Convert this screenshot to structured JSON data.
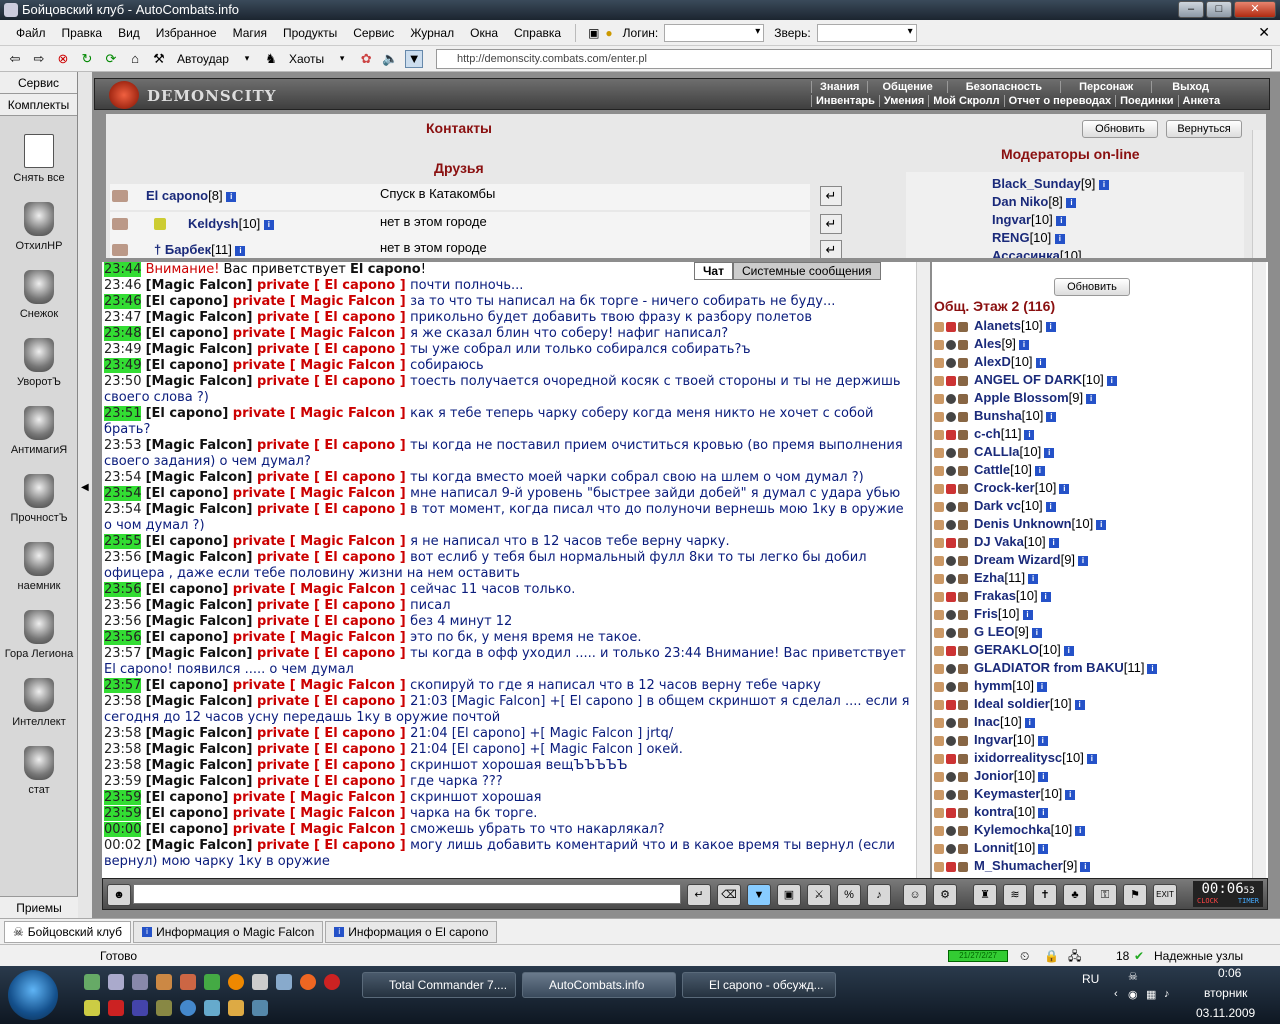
{
  "window": {
    "title": "Бойцовский клуб - AutoCombats.info"
  },
  "menu": {
    "items": [
      "Файл",
      "Правка",
      "Вид",
      "Избранное",
      "Магия",
      "Продукты",
      "Сервис",
      "Журнал",
      "Окна",
      "Справка"
    ],
    "login_label": "Логин:",
    "beast_label": "Зверь:"
  },
  "toolbar": {
    "autoudar": "Автоудар",
    "haoty": "Хаоты",
    "address": "http://demonscity.combats.com/enter.pl"
  },
  "leftpanel": {
    "tab1": "Сервис",
    "tab2": "Комплекты",
    "slots": [
      "Снять все",
      "ОтхилНР",
      "Снежок",
      "УворотЪ",
      "АнтимагиЯ",
      "ПрочностЪ",
      "наемник",
      "Гора Легиона",
      "Интеллект",
      "стат"
    ],
    "bottom": "Приемы"
  },
  "header": {
    "logo": "DEMONSCITY",
    "nav1": [
      "Знания",
      "Общение",
      "Безопасность",
      "Персонаж",
      "Выход"
    ],
    "nav2": [
      "Инвентарь",
      "Умения",
      "Мой Скролл",
      "Отчет о переводах",
      "Поединки",
      "Анкета"
    ]
  },
  "contacts": {
    "title": "Контакты",
    "friends_title": "Друзья",
    "refresh": "Обновить",
    "back": "Вернуться",
    "mods_title": "Модераторы on-line",
    "friends": [
      {
        "name": "El capono",
        "level": "[8]",
        "status": "Спуск в Катакомбы"
      },
      {
        "name": "Keldysh",
        "level": "[10]",
        "status": "нет в этом городе"
      },
      {
        "name": "Барбек",
        "level": "[11]",
        "status": "нет в этом городе"
      }
    ],
    "mods": [
      {
        "name": "Black_Sunday",
        "level": "[9]"
      },
      {
        "name": "Dan Niko",
        "level": "[8]"
      },
      {
        "name": "Ingvar",
        "level": "[10]"
      },
      {
        "name": "RENG",
        "level": "[10]"
      },
      {
        "name": "Ассасинка",
        "level": "[10]"
      }
    ]
  },
  "chat": {
    "tab_chat": "Чат",
    "tab_sys": "Системные сообщения",
    "lines": [
      {
        "t": "23:44",
        "hl": true,
        "sys": true,
        "text": "Внимание! ",
        "text2": "Вас приветствует ",
        "nick": "El capono",
        "end": "!"
      },
      {
        "t": "23:46",
        "hl": false,
        "from": "Magic Falcon",
        "to": "El capono",
        "msg": "почти полночь..."
      },
      {
        "t": "23:46",
        "hl": true,
        "from": "El capono",
        "to": "Magic Falcon",
        "msg": "за то что ты написал на бк торге - ничего собирать не буду..."
      },
      {
        "t": "23:47",
        "hl": false,
        "from": "Magic Falcon",
        "to": "El capono",
        "msg": "прикольно будет добавить твою фразу к разбору полетов"
      },
      {
        "t": "23:48",
        "hl": true,
        "from": "El capono",
        "to": "Magic Falcon",
        "msg": "я же сказал блин что соберу! нафиг написал?"
      },
      {
        "t": "23:49",
        "hl": false,
        "from": "Magic Falcon",
        "to": "El capono",
        "msg": "ты уже собрал или только собирался собирать?ъ"
      },
      {
        "t": "23:49",
        "hl": true,
        "from": "El capono",
        "to": "Magic Falcon",
        "msg": "собираюсь"
      },
      {
        "t": "23:50",
        "hl": false,
        "from": "Magic Falcon",
        "to": "El capono",
        "msg": "тоесть получается очоредной косяк с твоей стороны и ты не держишь своего слова ?)"
      },
      {
        "t": "23:51",
        "hl": true,
        "from": "El capono",
        "to": "Magic Falcon",
        "msg": "как я тебе теперь чарку соберу когда меня никто не хочет с собой брать?"
      },
      {
        "t": "23:53",
        "hl": false,
        "from": "Magic Falcon",
        "to": "El capono",
        "msg": "ты когда не поставил прием очиститься кровью (во премя выполнения своего задания) о чем думал?"
      },
      {
        "t": "23:54",
        "hl": false,
        "from": "Magic Falcon",
        "to": "El capono",
        "msg": "ты когда вместо моей чарки собрал свою на шлем о чом думал ?)"
      },
      {
        "t": "23:54",
        "hl": true,
        "from": "El capono",
        "to": "Magic Falcon",
        "msg": "мне написал 9-й уровень \"быстрее зайди добей\" я думал с удара убью"
      },
      {
        "t": "23:54",
        "hl": false,
        "from": "Magic Falcon",
        "to": "El capono",
        "msg": "в тот момент, когда писал что до полуночи вернешь мою 1ку в оружие о чом думал ?)"
      },
      {
        "t": "23:55",
        "hl": true,
        "from": "El capono",
        "to": "Magic Falcon",
        "msg": "я не написал что в 12 часов тебе верну чарку."
      },
      {
        "t": "23:56",
        "hl": false,
        "from": "Magic Falcon",
        "to": "El capono",
        "msg": "вот еслиб у тебя был нормальный фулл 8ки то ты легко бы добил офицера , даже если тебе половину жизни на нем оставить"
      },
      {
        "t": "23:56",
        "hl": true,
        "from": "El capono",
        "to": "Magic Falcon",
        "msg": "сейчас 11 часов только."
      },
      {
        "t": "23:56",
        "hl": false,
        "from": "Magic Falcon",
        "to": "El capono",
        "msg": "писал"
      },
      {
        "t": "23:56",
        "hl": false,
        "from": "Magic Falcon",
        "to": "El capono",
        "msg": "без 4 минут 12"
      },
      {
        "t": "23:56",
        "hl": true,
        "from": "El capono",
        "to": "Magic Falcon",
        "msg": "это по бк, у меня время не такое."
      },
      {
        "t": "23:57",
        "hl": false,
        "from": "Magic Falcon",
        "to": "El capono",
        "msg": "ты когда в офф уходил ..... и только 23:44 Внимание! Вас приветствует El capono! появился ..... о чем думал"
      },
      {
        "t": "23:57",
        "hl": true,
        "from": "El capono",
        "to": "Magic Falcon",
        "msg": "скопируй то где я написал что в 12 часов верну тебе чарку"
      },
      {
        "t": "23:58",
        "hl": false,
        "from": "Magic Falcon",
        "to": "El capono",
        "msg": "21:03 [Magic Falcon] +[ El capono ] в общем скриншот я сделал .... если я сегодня до 12 часов усну передашь 1ку в оружие почтой"
      },
      {
        "t": "23:58",
        "hl": false,
        "from": "Magic Falcon",
        "to": "El capono",
        "msg": "21:04 [El capono] +[ Magic Falcon ] jrtq/"
      },
      {
        "t": "23:58",
        "hl": false,
        "from": "Magic Falcon",
        "to": "El capono",
        "msg": "21:04 [El capono] +[ Magic Falcon ] окей."
      },
      {
        "t": "23:58",
        "hl": false,
        "from": "Magic Falcon",
        "to": "El capono",
        "msg": "скриншот хорошая вещЪЪЪЪЪ"
      },
      {
        "t": "23:59",
        "hl": false,
        "from": "Magic Falcon",
        "to": "El capono",
        "msg": "где чарка ???"
      },
      {
        "t": "23:59",
        "hl": true,
        "from": "El capono",
        "to": "Magic Falcon",
        "msg": "скриншот хорошая"
      },
      {
        "t": "23:59",
        "hl": true,
        "from": "El capono",
        "to": "Magic Falcon",
        "msg": "чарка на бк торге."
      },
      {
        "t": "00:00",
        "hl": true,
        "from": "El capono",
        "to": "Magic Falcon",
        "msg": "сможешь убрать то что накарлякал?"
      },
      {
        "t": "00:02",
        "hl": false,
        "from": "Magic Falcon",
        "to": "El capono",
        "msg": "могу лишь добавить коментарий что и в какое время ты вернул (если вернул) мою чарку 1ку в оружие"
      }
    ],
    "private_word": "private"
  },
  "online": {
    "refresh": "Обновить",
    "header": "Общ. Этаж 2 (116)",
    "users": [
      {
        "name": "Alanets",
        "level": "[10]"
      },
      {
        "name": "Ales",
        "level": "[9]"
      },
      {
        "name": "AlexD",
        "level": "[10]"
      },
      {
        "name": "ANGEL OF DARK",
        "level": "[10]"
      },
      {
        "name": "Apple Blossom",
        "level": "[9]"
      },
      {
        "name": "Bunsha",
        "level": "[10]"
      },
      {
        "name": "c-ch",
        "level": "[11]"
      },
      {
        "name": "CALLIa",
        "level": "[10]"
      },
      {
        "name": "Cattle",
        "level": "[10]"
      },
      {
        "name": "Crock-ker",
        "level": "[10]"
      },
      {
        "name": "Dark vc",
        "level": "[10]"
      },
      {
        "name": "Denis Unknown",
        "level": "[10]"
      },
      {
        "name": "DJ Vaka",
        "level": "[10]"
      },
      {
        "name": "Dream Wizard",
        "level": "[9]"
      },
      {
        "name": "Ezha",
        "level": "[11]"
      },
      {
        "name": "Frakas",
        "level": "[10]"
      },
      {
        "name": "Fris",
        "level": "[10]"
      },
      {
        "name": "G LEO",
        "level": "[9]"
      },
      {
        "name": "GERAKLO",
        "level": "[10]"
      },
      {
        "name": "GLADIATOR from BAKU",
        "level": "[11]"
      },
      {
        "name": "hymm",
        "level": "[10]"
      },
      {
        "name": "Ideal soldier",
        "level": "[10]"
      },
      {
        "name": "Inac",
        "level": "[10]"
      },
      {
        "name": "Ingvar",
        "level": "[10]"
      },
      {
        "name": "ixidorrealitysc",
        "level": "[10]"
      },
      {
        "name": "Jonior",
        "level": "[10]"
      },
      {
        "name": "Keymaster",
        "level": "[10]"
      },
      {
        "name": "kontra",
        "level": "[10]"
      },
      {
        "name": "Kylemochka",
        "level": "[10]"
      },
      {
        "name": "Lonnit",
        "level": "[10]"
      },
      {
        "name": "M_Shumacher",
        "level": "[9]"
      }
    ]
  },
  "bottom": {
    "clock": "00:06",
    "clock_sec": "53",
    "clock_label": "CLOCK",
    "timer_label": "TIMER",
    "exit_label": "EXIT"
  },
  "ietabs": [
    "Бойцовский клуб",
    "Информация о Magic Falcon",
    "Информация о El capono"
  ],
  "status": {
    "ready": "Готово",
    "count": "18",
    "trusted": "Надежные узлы",
    "progress": "21/27/2/27"
  },
  "taskbar": {
    "windows": [
      "Total Commander 7....",
      "AutoCombats.info",
      "El capono - обсужд..."
    ],
    "lang": "RU",
    "time": "0:06",
    "day": "вторник",
    "date": "03.11.2009"
  }
}
